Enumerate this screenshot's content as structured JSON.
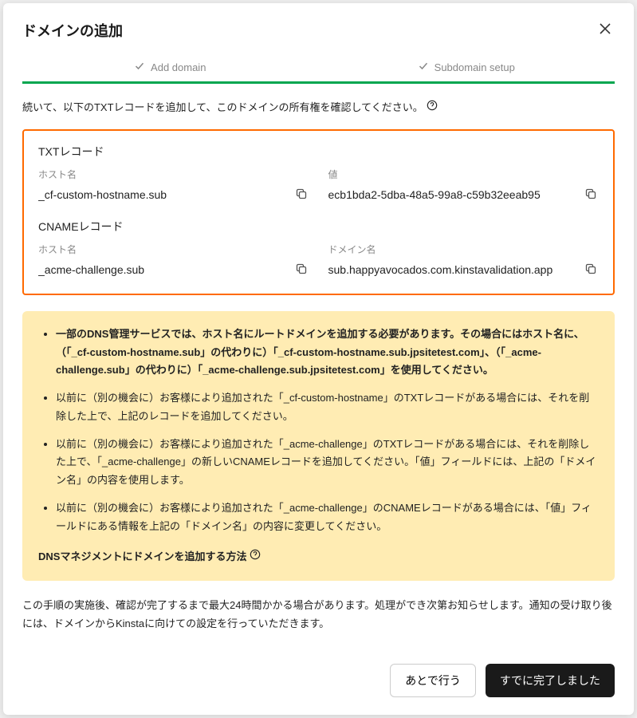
{
  "header": {
    "title": "ドメインの追加"
  },
  "stepper": {
    "step1": "Add domain",
    "step2": "Subdomain setup"
  },
  "intro": "続いて、以下のTXTレコードを追加して、このドメインの所有権を確認してください。",
  "records": {
    "txt": {
      "type_label": "TXTレコード",
      "host_label": "ホスト名",
      "host_value": "_cf-custom-hostname.sub",
      "value_label": "値",
      "value_value": "ecb1bda2-5dba-48a5-99a8-c59b32eeab95"
    },
    "cname": {
      "type_label": "CNAMEレコード",
      "host_label": "ホスト名",
      "host_value": "_acme-challenge.sub",
      "domain_label": "ドメイン名",
      "domain_value": "sub.happyavocados.com.kinstavalidation.app"
    }
  },
  "info": {
    "item1_prefix": "一部のDNS管理サービスでは、ホスト名にルートドメインを追加する必要があります。その場合にはホスト名に、（「_cf-custom-hostname.sub」の代わりに）「_cf-custom-hostname.sub.jpsitetest.com」、（「_acme-challenge.sub」の代わりに）「_acme-challenge.sub.jpsitetest.com」を使用してください。",
    "item2": "以前に（別の機会に）お客様により追加された「_cf-custom-hostname」のTXTレコードがある場合には、それを削除した上で、上記のレコードを追加してください。",
    "item3": "以前に（別の機会に）お客様により追加された「_acme-challenge」のTXTレコードがある場合には、それを削除した上で、「_acme-challenge」の新しいCNAMEレコードを追加してください。「値」フィールドには、上記の「ドメイン名」の内容を使用します。",
    "item4": "以前に（別の機会に）お客様により追加された「_acme-challenge」のCNAMEレコードがある場合には、「値」フィールドにある情報を上記の「ドメイン名」の内容に変更してください。",
    "link": "DNSマネジメントにドメインを追加する方法"
  },
  "followup": "この手順の実施後、確認が完了するまで最大24時間かかる場合があります。処理ができ次第お知らせします。通知の受け取り後には、ドメインからKinstaに向けての設定を行っていただきます。",
  "footer": {
    "later": "あとで行う",
    "done": "すでに完了しました"
  }
}
